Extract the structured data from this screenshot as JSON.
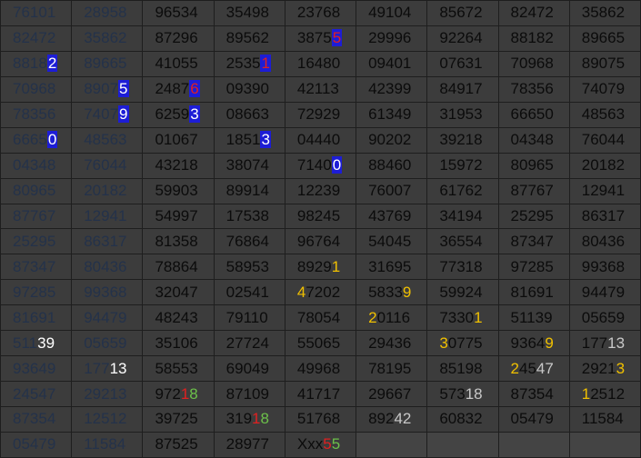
{
  "colors": {
    "background": "#3c3c3c",
    "grid_line": "#1e1e1e",
    "text": "#0b0b0b",
    "faded_text": "#24324a",
    "blue_highlight": "#1d1dd6",
    "red": "#e02020",
    "yellow": "#f0c000",
    "white": "#ffffff",
    "light_gray": "#c8c8c8",
    "green": "#6cc04a"
  },
  "grid": {
    "rows": [
      [
        {
          "t": "76101",
          "f": 1
        },
        {
          "t": "28958",
          "f": 1
        },
        {
          "t": "96534"
        },
        {
          "t": "35498"
        },
        {
          "t": "23768"
        },
        {
          "t": "49104"
        },
        {
          "t": "85672"
        },
        {
          "t": "82472"
        },
        {
          "t": "35862"
        }
      ],
      [
        {
          "t": "82472",
          "f": 1
        },
        {
          "t": "35862",
          "f": 1
        },
        {
          "t": "87296"
        },
        {
          "t": "89562"
        },
        {
          "p": [
            {
              "t": "3875"
            },
            {
              "t": "5",
              "c": "red",
              "bg": "blue_highlight"
            }
          ]
        },
        {
          "t": "29996"
        },
        {
          "t": "92264"
        },
        {
          "t": "88182"
        },
        {
          "t": "89665"
        }
      ],
      [
        {
          "f": 1,
          "p": [
            {
              "t": "8818"
            },
            {
              "t": "2",
              "c": "white",
              "bg": "blue_highlight"
            }
          ]
        },
        {
          "t": "89665",
          "f": 1
        },
        {
          "t": "41055"
        },
        {
          "p": [
            {
              "t": "2535"
            },
            {
              "t": "1",
              "c": "red",
              "bg": "blue_highlight"
            }
          ]
        },
        {
          "t": "16480"
        },
        {
          "t": "09401"
        },
        {
          "t": "07631"
        },
        {
          "t": "70968"
        },
        {
          "t": "89075"
        }
      ],
      [
        {
          "t": "70968",
          "f": 1
        },
        {
          "f": 1,
          "p": [
            {
              "t": "8907"
            },
            {
              "t": "5",
              "c": "white",
              "bg": "blue_highlight"
            }
          ]
        },
        {
          "p": [
            {
              "t": "2487"
            },
            {
              "t": "6",
              "c": "red",
              "bg": "blue_highlight"
            }
          ]
        },
        {
          "t": "09390"
        },
        {
          "t": "42113"
        },
        {
          "t": "42399"
        },
        {
          "t": "84917"
        },
        {
          "t": "78356"
        },
        {
          "t": "74079"
        }
      ],
      [
        {
          "t": "78356",
          "f": 1
        },
        {
          "f": 1,
          "p": [
            {
              "t": "7407"
            },
            {
              "t": "9",
              "c": "white",
              "bg": "blue_highlight"
            }
          ]
        },
        {
          "p": [
            {
              "t": "6259"
            },
            {
              "t": "3",
              "c": "white",
              "bg": "blue_highlight"
            }
          ]
        },
        {
          "t": "08663"
        },
        {
          "t": "72929"
        },
        {
          "t": "61349"
        },
        {
          "t": "31953"
        },
        {
          "t": "66650"
        },
        {
          "t": "48563"
        }
      ],
      [
        {
          "f": 1,
          "p": [
            {
              "t": "6665"
            },
            {
              "t": "0",
              "c": "white",
              "bg": "blue_highlight"
            }
          ]
        },
        {
          "t": "48563",
          "f": 1
        },
        {
          "t": "01067"
        },
        {
          "p": [
            {
              "t": "1851"
            },
            {
              "t": "3",
              "c": "white",
              "bg": "blue_highlight"
            }
          ]
        },
        {
          "t": "04440"
        },
        {
          "t": "90202"
        },
        {
          "t": "39218"
        },
        {
          "t": "04348"
        },
        {
          "t": "76044"
        }
      ],
      [
        {
          "t": "04348",
          "f": 1
        },
        {
          "t": "76044",
          "f": 1
        },
        {
          "t": "43218"
        },
        {
          "t": "38074"
        },
        {
          "p": [
            {
              "t": "7140"
            },
            {
              "t": "0",
              "c": "white",
              "bg": "blue_highlight"
            }
          ]
        },
        {
          "t": "88460"
        },
        {
          "t": "15972"
        },
        {
          "t": "80965"
        },
        {
          "t": "20182"
        }
      ],
      [
        {
          "t": "80965",
          "f": 1
        },
        {
          "t": "20182",
          "f": 1
        },
        {
          "t": "59903"
        },
        {
          "t": "89914"
        },
        {
          "t": "12239"
        },
        {
          "t": "76007"
        },
        {
          "t": "61762"
        },
        {
          "t": "87767"
        },
        {
          "t": "12941"
        }
      ],
      [
        {
          "t": "87767",
          "f": 1
        },
        {
          "t": "12941",
          "f": 1
        },
        {
          "t": "54997"
        },
        {
          "t": "17538"
        },
        {
          "t": "98245"
        },
        {
          "t": "43769"
        },
        {
          "t": "34194"
        },
        {
          "t": "25295"
        },
        {
          "t": "86317"
        }
      ],
      [
        {
          "t": "25295",
          "f": 1
        },
        {
          "t": "86317",
          "f": 1
        },
        {
          "t": "81358"
        },
        {
          "t": "76864"
        },
        {
          "t": "96764"
        },
        {
          "t": "54045"
        },
        {
          "t": "36554"
        },
        {
          "t": "87347"
        },
        {
          "t": "80436"
        }
      ],
      [
        {
          "t": "87347",
          "f": 1
        },
        {
          "t": "80436",
          "f": 1
        },
        {
          "t": "78864"
        },
        {
          "t": "58953"
        },
        {
          "p": [
            {
              "t": "8929"
            },
            {
              "t": "1",
              "c": "yellow"
            }
          ]
        },
        {
          "t": "31695"
        },
        {
          "t": "77318"
        },
        {
          "t": "97285"
        },
        {
          "t": "99368"
        }
      ],
      [
        {
          "t": "97285",
          "f": 1
        },
        {
          "t": "99368",
          "f": 1
        },
        {
          "t": "32047"
        },
        {
          "t": "02541"
        },
        {
          "p": [
            {
              "t": "4",
              "c": "yellow"
            },
            {
              "t": "7202"
            }
          ]
        },
        {
          "p": [
            {
              "t": "5833"
            },
            {
              "t": "9",
              "c": "yellow"
            }
          ]
        },
        {
          "t": "59924"
        },
        {
          "t": "81691"
        },
        {
          "t": "94479"
        }
      ],
      [
        {
          "t": "81691",
          "f": 1
        },
        {
          "t": "94479",
          "f": 1
        },
        {
          "t": "48243"
        },
        {
          "t": "79110"
        },
        {
          "t": "78054"
        },
        {
          "p": [
            {
              "t": "2",
              "c": "yellow"
            },
            {
              "t": "0116"
            }
          ]
        },
        {
          "p": [
            {
              "t": "7330"
            },
            {
              "t": "1",
              "c": "yellow"
            }
          ]
        },
        {
          "t": "51139"
        },
        {
          "t": "05659"
        }
      ],
      [
        {
          "f": 1,
          "p": [
            {
              "t": "511"
            },
            {
              "t": "39",
              "c": "white"
            }
          ]
        },
        {
          "t": "05659",
          "f": 1
        },
        {
          "t": "35106"
        },
        {
          "t": "27724"
        },
        {
          "t": "55065"
        },
        {
          "t": "29436"
        },
        {
          "p": [
            {
              "t": "3",
              "c": "yellow"
            },
            {
              "t": "0775"
            }
          ]
        },
        {
          "p": [
            {
              "t": "9364"
            },
            {
              "t": "9",
              "c": "yellow"
            }
          ]
        },
        {
          "p": [
            {
              "t": "177"
            },
            {
              "t": "13",
              "c": "light_gray"
            }
          ]
        }
      ],
      [
        {
          "t": "93649",
          "f": 1
        },
        {
          "f": 1,
          "p": [
            {
              "t": "177"
            },
            {
              "t": "13",
              "c": "white"
            }
          ]
        },
        {
          "t": "58553"
        },
        {
          "t": "69049"
        },
        {
          "t": "49968"
        },
        {
          "t": "78195"
        },
        {
          "t": "85198"
        },
        {
          "p": [
            {
              "t": "2",
              "c": "yellow"
            },
            {
              "t": "45"
            },
            {
              "t": "47",
              "c": "light_gray"
            }
          ]
        },
        {
          "p": [
            {
              "t": "2921"
            },
            {
              "t": "3",
              "c": "yellow"
            }
          ]
        }
      ],
      [
        {
          "t": "24547",
          "f": 1
        },
        {
          "t": "29213",
          "f": 1
        },
        {
          "p": [
            {
              "t": "972"
            },
            {
              "t": "1",
              "c": "red"
            },
            {
              "t": "8",
              "c": "green"
            }
          ]
        },
        {
          "t": "87109"
        },
        {
          "t": "41717"
        },
        {
          "t": "29667"
        },
        {
          "p": [
            {
              "t": "573"
            },
            {
              "t": "18",
              "c": "light_gray"
            }
          ]
        },
        {
          "t": "87354"
        },
        {
          "p": [
            {
              "t": "1",
              "c": "yellow"
            },
            {
              "t": "2512"
            }
          ]
        }
      ],
      [
        {
          "t": "87354",
          "f": 1
        },
        {
          "t": "12512",
          "f": 1
        },
        {
          "t": "39725"
        },
        {
          "p": [
            {
              "t": "319"
            },
            {
              "t": "1",
              "c": "red"
            },
            {
              "t": "8",
              "c": "green"
            }
          ]
        },
        {
          "t": "51768"
        },
        {
          "p": [
            {
              "t": "892"
            },
            {
              "t": "42",
              "c": "light_gray"
            }
          ]
        },
        {
          "t": "60832"
        },
        {
          "t": "05479"
        },
        {
          "t": "11584"
        }
      ],
      [
        {
          "t": "05479",
          "f": 1
        },
        {
          "t": "11584",
          "f": 1
        },
        {
          "t": "87525"
        },
        {
          "t": "28977"
        },
        {
          "p": [
            {
              "t": "Xxx"
            },
            {
              "t": "5",
              "c": "red"
            },
            {
              "t": "5",
              "c": "green"
            }
          ]
        },
        {
          "t": "",
          "b": 1
        },
        {
          "t": "",
          "b": 1
        },
        {
          "t": "",
          "b": 1
        },
        {
          "t": "",
          "b": 1
        }
      ]
    ]
  }
}
